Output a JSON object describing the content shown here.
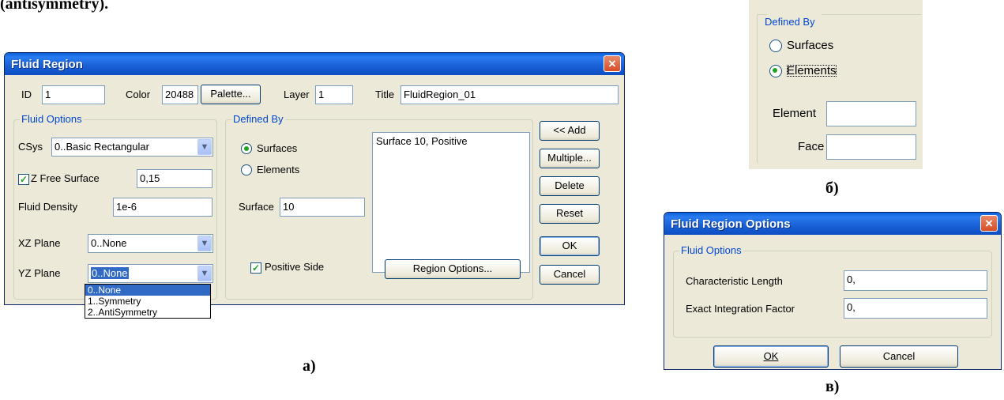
{
  "top_text": "(antisymmetry).",
  "dialog_a": {
    "title": "Fluid Region",
    "close_glyph": "×",
    "id_label": "ID",
    "id_value": "1",
    "color_label": "Color",
    "color_value": "20488",
    "palette_button": "Palette...",
    "layer_label": "Layer",
    "layer_value": "1",
    "title_label": "Title",
    "title_value": "FluidRegion_01",
    "fluid_options": {
      "caption": "Fluid Options",
      "csys_label": "CSys",
      "csys_value": "0..Basic Rectangular",
      "z_free_surface_label": "Z Free Surface",
      "z_free_surface_checked": true,
      "z_free_surface_value": "0,15",
      "fluid_density_label": "Fluid Density",
      "fluid_density_value": "1e-6",
      "xz_plane_label": "XZ Plane",
      "xz_plane_value": "0..None",
      "yz_plane_label": "YZ Plane",
      "yz_plane_value": "0..None",
      "yz_plane_options": [
        "0..None",
        "1..Symmetry",
        "2..AntiSymmetry"
      ]
    },
    "defined_by": {
      "caption": "Defined By",
      "surfaces_label": "Surfaces",
      "elements_label": "Elements",
      "selected": "Surfaces",
      "surface_label": "Surface",
      "surface_value": "10",
      "list_items": [
        "Surface 10, Positive"
      ],
      "positive_side_label": "Positive Side",
      "positive_side_checked": true,
      "region_options_button": "Region Options..."
    },
    "buttons": {
      "add": "<< Add",
      "multiple": "Multiple...",
      "delete": "Delete",
      "reset": "Reset",
      "ok": "OK",
      "cancel": "Cancel"
    },
    "check_glyph": "✓",
    "arrow_glyph": "▼",
    "caption": "а)"
  },
  "panel_b": {
    "caption_group": "Defined By",
    "surfaces_label": "Surfaces",
    "elements_label": "Elements",
    "selected": "Elements",
    "element_label": "Element",
    "element_value": "",
    "face_label": "Face",
    "face_value": "",
    "caption": "б)"
  },
  "dialog_c": {
    "title": "Fluid Region Options",
    "close_glyph": "×",
    "group_caption": "Fluid Options",
    "characteristic_length_label": "Characteristic Length",
    "characteristic_length_value": "0,",
    "exact_integration_label": "Exact Integration Factor",
    "exact_integration_value": "0,",
    "ok_button": "OK",
    "cancel_button": "Cancel",
    "caption": "в)"
  },
  "colors": {
    "title_bar": "#0a5fdc",
    "group_caption": "#0046d5",
    "dialog_bg": "#ece9d8",
    "selection": "#316ac5"
  }
}
